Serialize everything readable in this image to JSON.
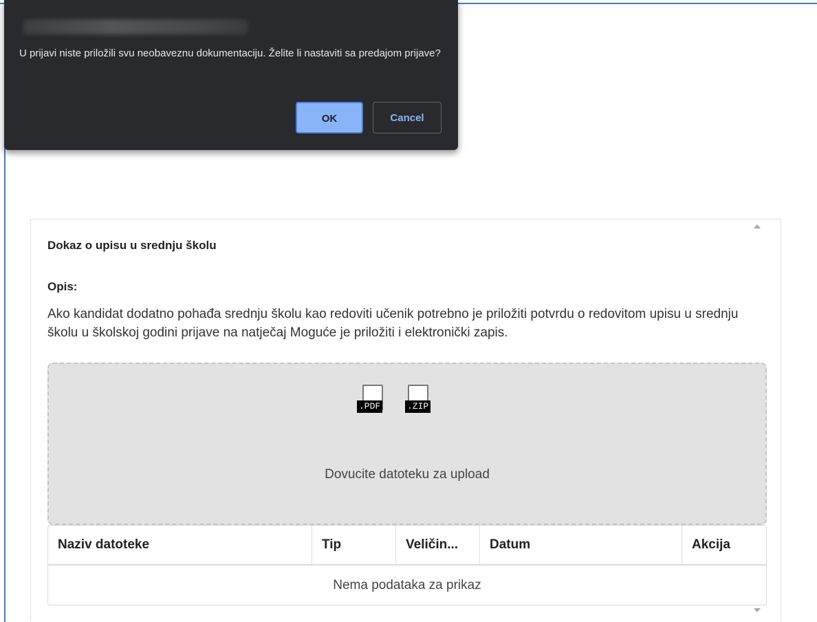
{
  "dialog": {
    "message": "U prijavi niste priložili svu neobaveznu dokumentaciju. Želite li nastaviti sa predajom prijave?",
    "ok_label": "OK",
    "cancel_label": "Cancel",
    "accent_color": "#8ab4f8",
    "background_color": "#292a2d"
  },
  "panel": {
    "title": "Dokaz o upisu u srednju školu",
    "description_label": "Opis:",
    "description": "Ako kandidat dodatno pohađa srednju školu kao redoviti učenik potrebno je priložiti potvrdu o redovitom upisu u srednju školu u školskoj godini prijave na natječaj Moguće je priložiti i elektronički zapis."
  },
  "dropzone": {
    "file_types": [
      ".PDF",
      ".ZIP"
    ],
    "hint": "Dovucite datoteku za upload"
  },
  "table": {
    "columns": [
      "Naziv datoteke",
      "Tip",
      "Veličin...",
      "Datum",
      "Akcija"
    ],
    "empty_message": "Nema podataka za prikaz"
  },
  "icons": [
    "pdf-file-icon",
    "zip-file-icon",
    "scroll-up-arrow-icon",
    "scroll-down-arrow-icon"
  ]
}
